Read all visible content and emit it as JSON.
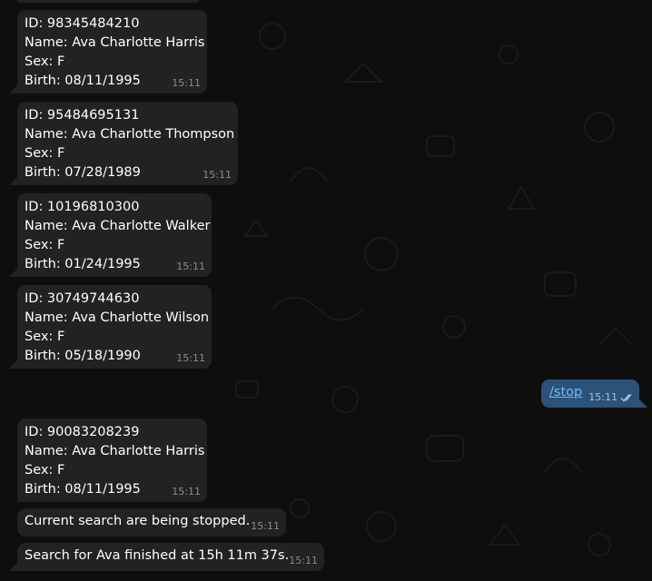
{
  "messages": [
    {
      "lines": [
        "ID: 98345484210",
        "Name: Ava Charlotte Harris",
        "Sex: F",
        "Birth: 08/11/1995"
      ],
      "time": "15:11"
    },
    {
      "lines": [
        "ID: 95484695131",
        "Name: Ava Charlotte Thompson",
        "Sex: F",
        "Birth: 07/28/1989"
      ],
      "time": "15:11"
    },
    {
      "lines": [
        "ID: 10196810300",
        "Name: Ava Charlotte Walker",
        "Sex: F",
        "Birth: 01/24/1995"
      ],
      "time": "15:11"
    },
    {
      "lines": [
        "ID: 30749744630",
        "Name: Ava Charlotte Wilson",
        "Sex: F",
        "Birth: 05/18/1990"
      ],
      "time": "15:11"
    },
    {
      "lines": [
        "ID: 90083208239",
        "Name: Ava Charlotte Harris",
        "Sex: F",
        "Birth: 08/11/1995"
      ],
      "time": "15:11"
    },
    {
      "lines": [
        "Current search are being stopped."
      ],
      "time": "15:11"
    },
    {
      "lines": [
        "Search for Ava finished at 15h 11m 37s."
      ],
      "time": "15:11"
    }
  ],
  "outgoing": {
    "text": "/stop",
    "time": "15:11",
    "status_icon": "double-check-icon"
  },
  "colors": {
    "background": "#0e0e0e",
    "incoming_bubble": "#222222",
    "outgoing_bubble": "#2b5278",
    "link": "#71baf7",
    "timestamp": "#8b8b8b"
  }
}
